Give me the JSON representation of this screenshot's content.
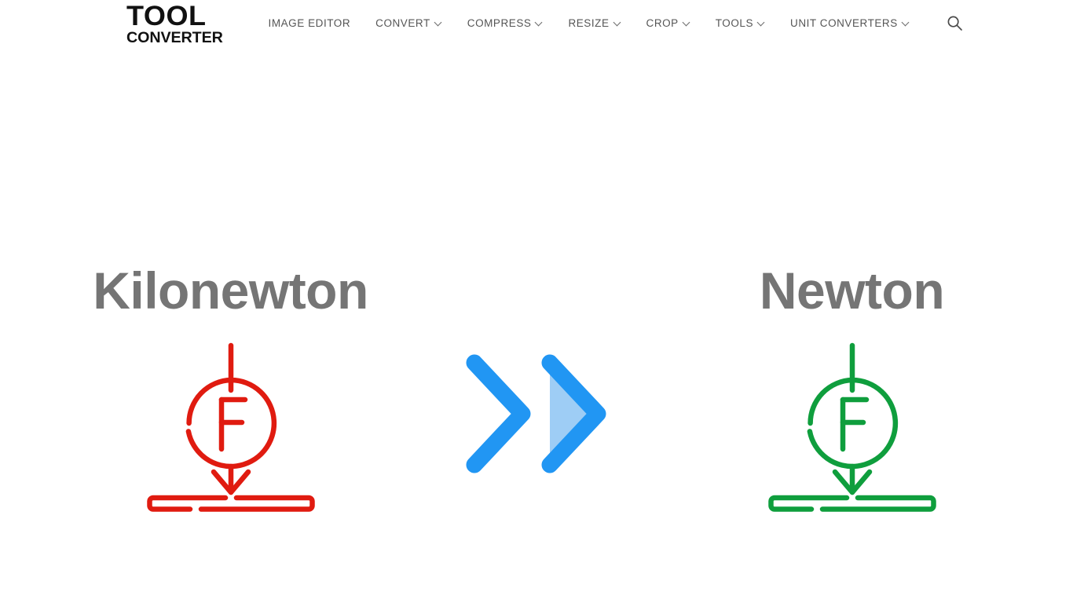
{
  "header": {
    "logo": {
      "line1": "TOOL",
      "line2": "CONVERTER"
    },
    "nav": [
      {
        "label": "IMAGE EDITOR",
        "has_dropdown": false
      },
      {
        "label": "CONVERT",
        "has_dropdown": true
      },
      {
        "label": "COMPRESS",
        "has_dropdown": true
      },
      {
        "label": "RESIZE",
        "has_dropdown": true
      },
      {
        "label": "CROP",
        "has_dropdown": true
      },
      {
        "label": "TOOLS",
        "has_dropdown": true
      },
      {
        "label": "UNIT CONVERTERS",
        "has_dropdown": true
      }
    ],
    "search_icon": "search-icon"
  },
  "converter": {
    "source": {
      "title": "Kilonewton",
      "icon": "force-on-surface-icon",
      "icon_letter": "F",
      "color": "#e01b10"
    },
    "target": {
      "title": "Newton",
      "icon": "force-on-surface-icon",
      "icon_letter": "F",
      "color": "#0f9e3d"
    },
    "arrows": {
      "icon": "double-chevron-right-icon",
      "stroke_color": "#2196f3",
      "fill_color": "#9ecdf5"
    }
  },
  "colors": {
    "title_gray": "#757575",
    "nav_gray": "#555555",
    "logo_black": "#111111",
    "background": "#ffffff"
  }
}
